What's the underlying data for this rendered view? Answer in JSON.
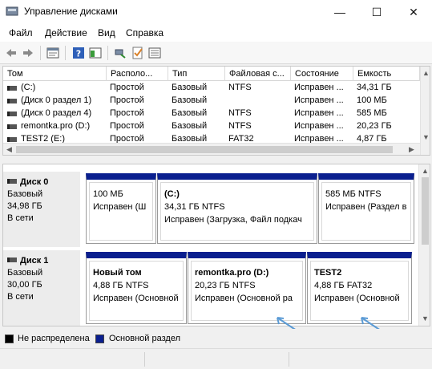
{
  "window": {
    "title": "Управление дисками",
    "min_glyph": "—",
    "max_glyph": "☐",
    "close_glyph": "✕"
  },
  "menu": [
    "Файл",
    "Действие",
    "Вид",
    "Справка"
  ],
  "toolbar": {
    "icons": [
      "back-arrow-icon",
      "forward-arrow-icon",
      "properties-icon",
      "help-icon",
      "console-tree-icon",
      "connect-icon",
      "checklist-icon",
      "list-view-icon"
    ]
  },
  "volume_list": {
    "columns": [
      "Том",
      "Располо...",
      "Тип",
      "Файловая с...",
      "Состояние",
      "Емкость"
    ],
    "rows": [
      [
        "(C:)",
        "Простой",
        "Базовый",
        "NTFS",
        "Исправен ...",
        "34,31 ГБ"
      ],
      [
        "(Диск 0 раздел 1)",
        "Простой",
        "Базовый",
        "",
        "Исправен ...",
        "100 МБ"
      ],
      [
        "(Диск 0 раздел 4)",
        "Простой",
        "Базовый",
        "NTFS",
        "Исправен ...",
        "585 МБ"
      ],
      [
        "remontka.pro (D:)",
        "Простой",
        "Базовый",
        "NTFS",
        "Исправен ...",
        "20,23 ГБ"
      ],
      [
        "TEST2 (E:)",
        "Простой",
        "Базовый",
        "FAT32",
        "Исправен ...",
        "4,87 ГБ"
      ]
    ]
  },
  "disks": [
    {
      "name": "Диск 0",
      "type": "Базовый",
      "size": "34,98 ГБ",
      "status": "В сети",
      "partitions": [
        {
          "name": "",
          "size": "100 МБ",
          "status": "Исправен (Ш"
        },
        {
          "name": "(C:)",
          "size": "34,31 ГБ NTFS",
          "status": "Исправен (Загрузка, Файл подкач"
        },
        {
          "name": "",
          "size": "585 МБ NTFS",
          "status": "Исправен (Раздел в"
        }
      ]
    },
    {
      "name": "Диск 1",
      "type": "Базовый",
      "size": "30,00 ГБ",
      "status": "В сети",
      "partitions": [
        {
          "name": "Новый том",
          "size": "4,88 ГБ NTFS",
          "status": "Исправен (Основной"
        },
        {
          "name": "remontka.pro  (D:)",
          "size": "20,23 ГБ NTFS",
          "status": "Исправен (Основной ра"
        },
        {
          "name": "TEST2",
          "size": "4,88 ГБ FAT32",
          "status": "Исправен (Основной"
        }
      ]
    }
  ],
  "legend": [
    {
      "label": "Не распределена",
      "color": "#000000"
    },
    {
      "label": "Основной раздел",
      "color": "#0a1f8f"
    }
  ],
  "colors": {
    "partition_header": "#0a1f8f",
    "annotation_arrow": "#5b9bd5"
  }
}
